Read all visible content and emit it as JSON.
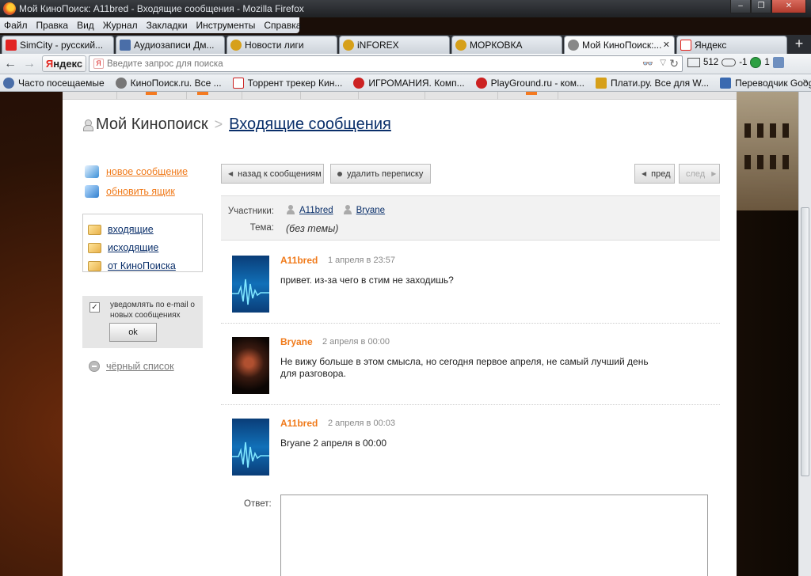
{
  "window": {
    "title": "Мой КиноПоиск: A11bred - Входящие сообщения - Mozilla Firefox",
    "minimize": "–",
    "maximize": "❐",
    "close": "✕"
  },
  "menu": [
    "Файл",
    "Правка",
    "Вид",
    "Журнал",
    "Закладки",
    "Инструменты",
    "Справка"
  ],
  "tabs": [
    {
      "label": "SimCity - русский...",
      "icon_color": "#e22222"
    },
    {
      "label": "Аудиозаписи Дм...",
      "icon_color": "#4a6ea8"
    },
    {
      "label": "Новости лиги",
      "icon_color": "#d6a01a"
    },
    {
      "label": "iNFOREX",
      "icon_color": "#d6a01a"
    },
    {
      "label": "МОРКОВКА",
      "icon_color": "#d6a01a"
    },
    {
      "label": "Мой КиноПоиск:...",
      "icon_color": "#888888"
    },
    {
      "label": "Яндекс",
      "icon_color": "#e3221b"
    }
  ],
  "tab_close": "✕",
  "new_tab": "+",
  "nav": {
    "back": "←",
    "forward": "→",
    "logo_first": "Я",
    "logo_rest": "ндекс",
    "search_icon": "Я",
    "search_placeholder": "Введите запрос для поиска",
    "glasses": "👓",
    "dropdown": "▽",
    "reload": "↻",
    "mail_count": "512",
    "weather": "-1",
    "rating": "1"
  },
  "bookmarks": [
    {
      "label": "Часто посещаемые",
      "icon_color": "#4a6ea8"
    },
    {
      "label": "КиноПоиск.ru. Все ...",
      "icon_color": "#777777"
    },
    {
      "label": "Торрент трекер Кин...",
      "icon_color": "#cc2222"
    },
    {
      "label": "ИГРОМАНИЯ. Комп...",
      "icon_color": "#cc2222"
    },
    {
      "label": "PlayGround.ru - ком...",
      "icon_color": "#cc2222"
    },
    {
      "label": "Плати.ру. Все для W...",
      "icon_color": "#d6a01a"
    },
    {
      "label": "Переводчик Google",
      "icon_color": "#3a6ab0"
    }
  ],
  "bookmarks_more": "»",
  "page": {
    "breadcrumb_home": "Мой Кинопоиск",
    "breadcrumb_sep": ">",
    "breadcrumb_page": "Входящие сообщения"
  },
  "sidebar": {
    "new_message": "новое сообщение",
    "refresh": "обновить ящик",
    "inbox": "входящие",
    "outbox": "исходящие",
    "from_kinopoisk": "от КиноПоиска",
    "notify_check": "✓",
    "notify_text": "уведомлять по e-mail о новых сообщениях",
    "ok": "ok",
    "blacklist": "чёрный список"
  },
  "toolbar": {
    "back_to_messages": "назад к сообщениям",
    "delete_thread": "удалить переписку",
    "prev": "пред",
    "next": "след",
    "arrow_left": "◀",
    "arrow_right": "▶"
  },
  "thread": {
    "participants_label": "Участники:",
    "participants": [
      "A11bred",
      "Bryane"
    ],
    "subject_label": "Тема:",
    "subject": "(без темы)"
  },
  "messages": [
    {
      "author": "A11bred",
      "date": "1 апреля в 23:57",
      "text": "привет. из-за чего в стим не заходишь?"
    },
    {
      "author": "Bryane",
      "date": "2 апреля в 00:00",
      "text": "Не вижу больше в этом смысла, но сегодня первое апреля, не самый лучший день для разговора."
    },
    {
      "author": "A11bred",
      "date": "2 апреля в 00:03",
      "text": "Bryane 2 апреля в 00:00"
    }
  ],
  "reply": {
    "label": "Ответ:"
  }
}
